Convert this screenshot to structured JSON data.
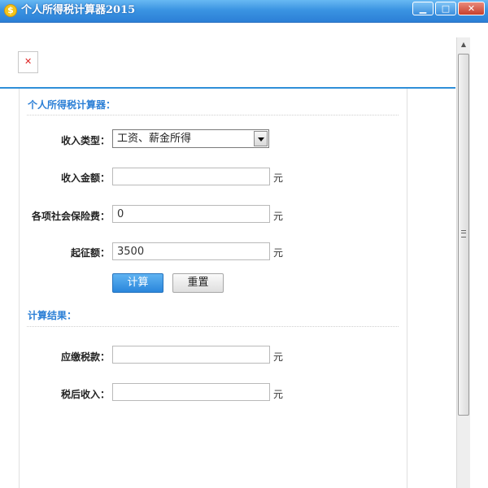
{
  "window": {
    "title": "个人所得税计算器2015",
    "icon": "dollar-coin-icon",
    "controls": {
      "minimize": "▁",
      "maximize": "□",
      "close": "✕"
    }
  },
  "image_placeholder": {
    "icon": "broken-image-icon",
    "glyph": "✕"
  },
  "calculator": {
    "section_title": "个人所得税计算器：",
    "income_type": {
      "label": "收入类型：",
      "value": "工资、薪金所得"
    },
    "income_amount": {
      "label": "收入金额：",
      "value": "",
      "unit": "元"
    },
    "social_insurance": {
      "label": "各项社会保险费：",
      "value": "0",
      "unit": "元"
    },
    "threshold": {
      "label": "起征额：",
      "value": "3500",
      "unit": "元"
    },
    "buttons": {
      "calculate": "计算",
      "reset": "重置"
    }
  },
  "results": {
    "section_title": "计算结果：",
    "tax_payable": {
      "label": "应缴税款：",
      "value": "",
      "unit": "元"
    },
    "after_tax_income": {
      "label": "税后收入：",
      "value": "",
      "unit": "元"
    }
  },
  "colors": {
    "accent": "#2f8fd8",
    "titlebar": "#3b94e2",
    "primary_button": "#2a86dc"
  }
}
